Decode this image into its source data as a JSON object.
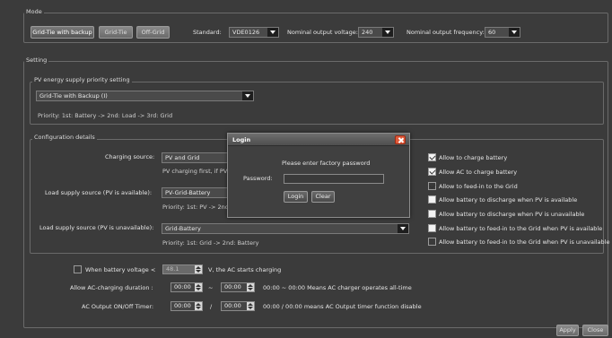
{
  "mode": {
    "title": "Mode",
    "buttons": [
      "Grid-Tie with backup",
      "Grid-Tie",
      "Off-Grid"
    ],
    "standard_label": "Standard:",
    "standard_value": "VDE0126",
    "voltage_label": "Nominal output voltage:",
    "voltage_value": "240",
    "frequency_label": "Nominal output frequency:",
    "frequency_value": "60"
  },
  "setting": {
    "title": "Setting",
    "pv_title": "PV energy supply priority setting",
    "pv_value": "Grid-Tie with Backup (I)",
    "pv_priority": "Priority: 1st: Battery -> 2nd: Load -> 3rd: Grid"
  },
  "config": {
    "title": "Configuration details",
    "charging_label": "Charging source:",
    "charging_value": "PV and Grid",
    "charging_note": "PV charging first, if PV p",
    "load_label": "Load supply source (PV is available):",
    "load_value": "PV-Grid-Battery",
    "load_priority": "Priority: 1st: PV -> 2nd:",
    "load_un_label": "Load supply source (PV is unavailable):",
    "load_un_value": "Grid-Battery",
    "load_un_priority": "Priority: 1st: Grid -> 2nd: Battery"
  },
  "checks": [
    {
      "label": "Allow to charge battery",
      "checked": true
    },
    {
      "label": "Allow AC to charge battery",
      "checked": true
    },
    {
      "label": "Allow to feed-in to the Grid",
      "checked": true
    },
    {
      "label": "Allow battery to discharge when PV is available",
      "checked": false
    },
    {
      "label": "Allow battery to discharge when PV is unavailable",
      "checked": false
    },
    {
      "label": "Allow battery to feed-in to the Grid when PV is available",
      "checked": false
    },
    {
      "label": "Allow battery to feed-in to the Grid when PV is unavailable",
      "checked": false
    }
  ],
  "battery": {
    "label": "When battery voltage <",
    "value": "48.1",
    "suffix": "V,  the AC starts charging"
  },
  "ac_charging": {
    "label": "Allow AC-charging duration :",
    "start": "00:00",
    "sep": "~",
    "end": "00:00",
    "note": "00:00 ~ 00:00 Means AC charger operates all-time"
  },
  "ac_timer": {
    "label": "AC Output ON/Off Timer:",
    "start": "00:00",
    "sep": "/",
    "end": "00:00",
    "note": "00:00 / 00:00 means AC Output timer function disable"
  },
  "footer": {
    "apply": "Apply",
    "close": "Close"
  },
  "dialog": {
    "title": "Login",
    "prompt": "Please enter factory password",
    "password_label": "Password:",
    "login": "Login",
    "clear": "Clear"
  }
}
